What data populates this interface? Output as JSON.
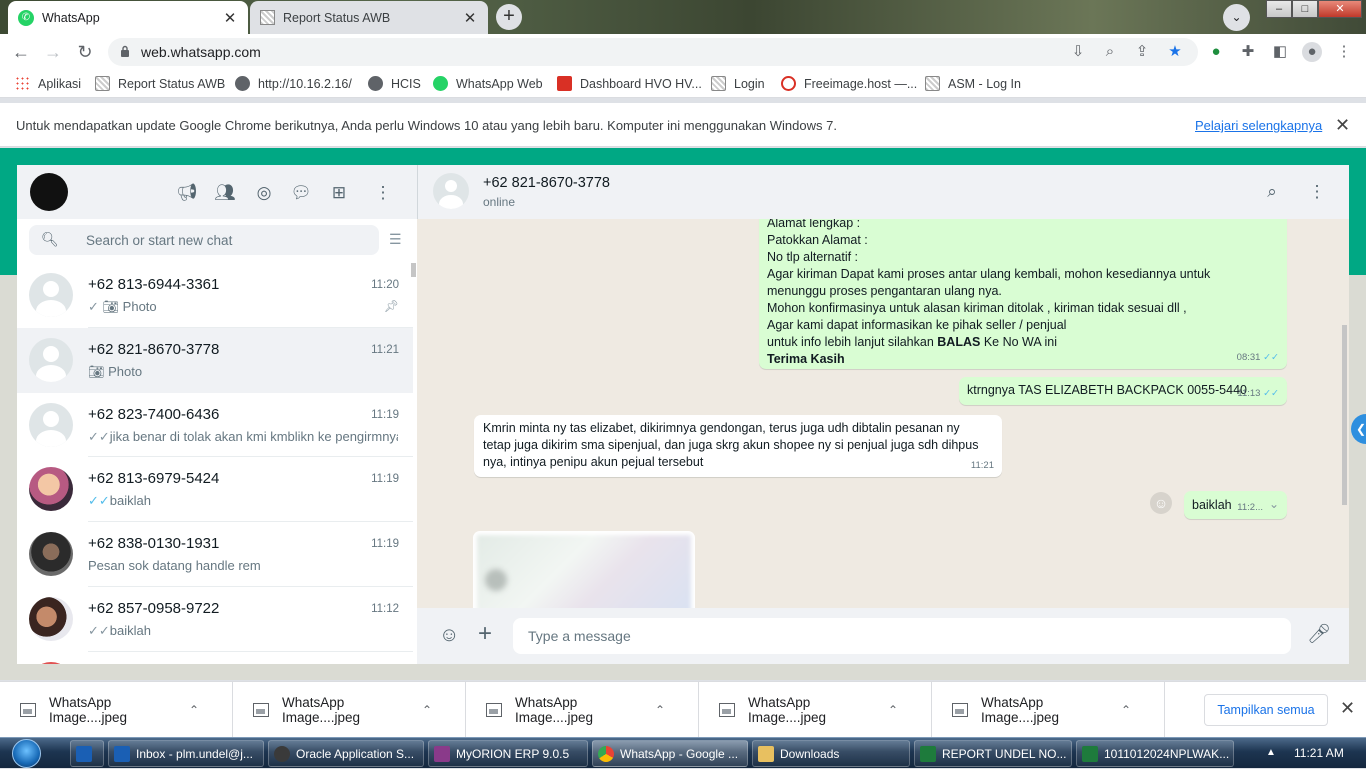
{
  "browser": {
    "tabs": [
      {
        "title": "WhatsApp",
        "active": true
      },
      {
        "title": "Report Status AWB",
        "active": false
      }
    ],
    "url": "web.whatsapp.com",
    "bookmarks": [
      {
        "label": "Aplikasi"
      },
      {
        "label": "Report Status AWB"
      },
      {
        "label": "http://10.16.2.16/"
      },
      {
        "label": "HCIS"
      },
      {
        "label": "WhatsApp Web"
      },
      {
        "label": "Dashboard HVO HV..."
      },
      {
        "label": "Login"
      },
      {
        "label": "Freeimage.host —..."
      },
      {
        "label": "ASM - Log In"
      }
    ],
    "infobar": {
      "message": "Untuk mendapatkan update Google Chrome berikutnya, Anda perlu Windows 10 atau yang lebih baru. Komputer ini menggunakan Windows 7.",
      "link": "Pelajari selengkapnya"
    }
  },
  "whatsapp": {
    "search_placeholder": "Search or start new chat",
    "chats": [
      {
        "name": "+62 813-6944-3361",
        "time": "11:20",
        "tick": "✓",
        "tick_color": "gray",
        "preview": "Photo",
        "photo": true,
        "pinned": true
      },
      {
        "name": "+62 821-8670-3778",
        "time": "11:21",
        "tick": "",
        "tick_color": "",
        "preview": "Photo",
        "photo": true,
        "selected": true
      },
      {
        "name": "+62 823-7400-6436",
        "time": "11:19",
        "tick": "✓✓",
        "tick_color": "gray",
        "preview": "jika benar di tolak akan kmi kmblikn ke pengirmnya"
      },
      {
        "name": "+62 813-6979-5424",
        "time": "11:19",
        "tick": "✓✓",
        "tick_color": "blue",
        "preview": "baiklah"
      },
      {
        "name": "+62 838-0130-1931",
        "time": "11:19",
        "tick": "",
        "tick_color": "",
        "preview": "Pesan sok datang handle rem"
      },
      {
        "name": "+62 857-0958-9722",
        "time": "11:12",
        "tick": "✓✓",
        "tick_color": "gray",
        "preview": "baiklah"
      }
    ],
    "conversation": {
      "contact": "+62 821-8670-3778",
      "status": "online",
      "msg1_lines": [
        "Alamat lengkap :",
        "Patokkan Alamat :",
        "No tlp alternatif :",
        "Agar kiriman Dapat kami proses antar ulang kembali, mohon kesediannya untuk",
        "menunggu proses pengantaran ulang nya.",
        "Mohon konfirmasinya untuk alasan kiriman ditolak , kiriman tidak sesuai dll ,",
        "Agar kami dapat informasikan ke pihak seller / penjual"
      ],
      "msg1_reply_prefix": "untuk info lebih lanjut silahkan",
      "msg1_reply_bold": "BALAS",
      "msg1_reply_suffix": "Ke No WA ini",
      "msg1_closing": "Terima Kasih",
      "msg1_time": "08:31",
      "msg2_text": "ktrngnya TAS ELIZABETH BACKPACK 0055-5440",
      "msg2_time": "11:13",
      "msg3_lines": [
        "Kmrin minta ny tas elizabet, dikirimnya  gendongan, terus juga udh dibtalin pesanan ny",
        "tetap juga dikirim sma sipenjual, dan juga skrg akun shopee ny si penjual  juga sdh dihpus",
        "nya, intinya penipu akun pejual tersebut"
      ],
      "msg3_time": "11:21",
      "msg4_text": "baiklah",
      "msg4_time": "11:2..."
    },
    "input_placeholder": "Type a message"
  },
  "downloads": {
    "items": [
      {
        "name": "WhatsApp Image....jpeg"
      },
      {
        "name": "WhatsApp Image....jpeg"
      },
      {
        "name": "WhatsApp Image....jpeg"
      },
      {
        "name": "WhatsApp Image....jpeg"
      },
      {
        "name": "WhatsApp Image....jpeg"
      }
    ],
    "show_all": "Tampilkan semua"
  },
  "taskbar": {
    "items": [
      {
        "label": "Inbox - plm.undel@j...",
        "color": "#1a5fb4"
      },
      {
        "label": "Oracle Application S...",
        "color": "#3a3a3a"
      },
      {
        "label": "MyORION ERP 9.0.5",
        "color": "#8a3a8a"
      },
      {
        "label": "WhatsApp - Google ...",
        "color": "#e0a020",
        "active": true
      },
      {
        "label": "Downloads",
        "color": "#e8c060"
      },
      {
        "label": "REPORT UNDEL NO...",
        "color": "#1e7b3c"
      },
      {
        "label": "1011012024NPLWAK...",
        "color": "#1e7b3c"
      }
    ],
    "clock": "11:21 AM"
  },
  "colors": {
    "whatsapp_green": "#00a884",
    "outgoing_bubble": "#d9fdd3",
    "chat_bg": "#efeae2",
    "link_blue": "#1a73e8"
  }
}
